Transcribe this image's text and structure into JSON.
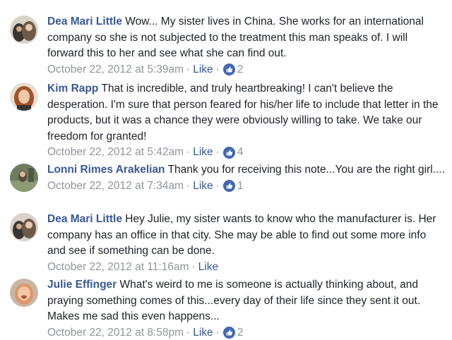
{
  "comments": [
    {
      "author": "Dea Mari Little",
      "text": "Wow... My sister lives in China. She works for an international company so she is not subjected to the treatment this man speaks of. I will forward this to her and see what she can find out.",
      "time": "October 22, 2012 at 5:39am",
      "like_label": "Like",
      "reaction_count": "2",
      "avatar_icon": "profile-photo-icon"
    },
    {
      "author": "Kim Rapp",
      "text": "That is incredible, and truly heartbreaking! I can't believe the desperation. I'm sure that person feared for his/her life to include that letter in the products, but it was a chance they were obviously willing to take. We take our freedom for granted!",
      "time": "October 22, 2012 at 5:42am",
      "like_label": "Like",
      "reaction_count": "4",
      "avatar_icon": "profile-photo-icon"
    },
    {
      "author": "Lonni Rimes Arakelian",
      "text": "Thank you for receiving this note...You are the right girl....",
      "time": "October 22, 2012 at 7:34am",
      "like_label": "Like",
      "reaction_count": "1",
      "avatar_icon": "profile-photo-icon"
    },
    {
      "author": "Dea Mari Little",
      "text": "Hey Julie, my sister wants to know who the manufacturer is. Her company has an office in that city. She may be able to find out some more info and see if something can be done.",
      "time": "October 22, 2012 at 11:16am",
      "like_label": "Like",
      "reaction_count": "",
      "avatar_icon": "profile-photo-icon"
    },
    {
      "author": "Julie Effinger",
      "text": "What's weird to me is someone is actually thinking about, and praying something comes of this...every day of their life since they sent it out. Makes me sad this even happens...",
      "time": "October 22, 2012 at 8:58pm",
      "like_label": "Like",
      "reaction_count": "2",
      "avatar_icon": "profile-photo-icon"
    }
  ],
  "colors": {
    "author": "#385898",
    "text": "#1d2129",
    "meta": "#90949c",
    "like_badge": "#4267b2"
  }
}
